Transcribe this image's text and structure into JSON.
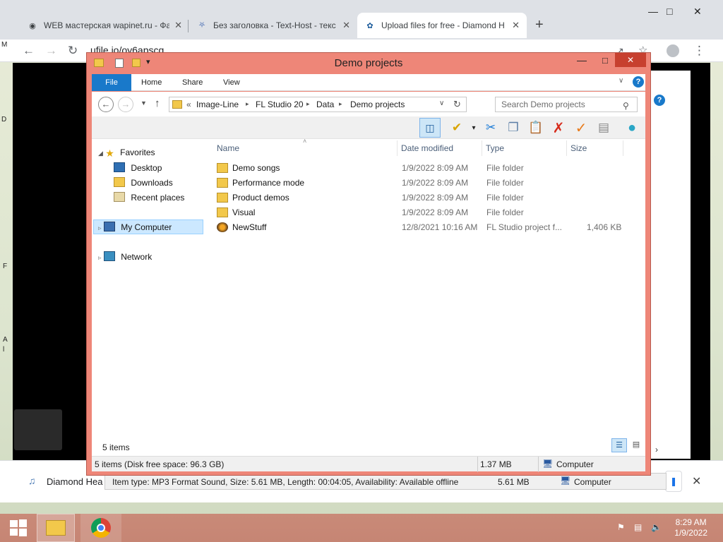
{
  "browser": {
    "tabs": [
      {
        "title": "WEB мастерская wapinet.ru - Фа",
        "icon": "eye-icon"
      },
      {
        "title": "Без заголовка - Text-Host - текс",
        "icon": "shield-icon"
      },
      {
        "title": "Upload files for free - Diamond H",
        "icon": "ufile-logo-icon",
        "active": true
      }
    ],
    "new_tab": "+",
    "url": "ufile.io/oy6apscg",
    "window_controls": {
      "minimize": "—",
      "maximize": "□",
      "close": "✕"
    }
  },
  "page": {
    "download_filename": "Diamond Hea",
    "side_letters": [
      "M",
      "D",
      "F",
      "A",
      "l"
    ]
  },
  "explorer": {
    "title": "Demo projects",
    "quick_access": {
      "dropdown": "▾"
    },
    "ribbon_tabs": [
      "File",
      "Home",
      "Share",
      "View"
    ],
    "address": {
      "prefix": "«",
      "crumbs": [
        "Image-Line",
        "FL Studio 20",
        "Data",
        "Demo projects"
      ]
    },
    "search_placeholder": "Search Demo projects",
    "nav": {
      "favorites": "Favorites",
      "favorite_items": [
        "Desktop",
        "Downloads",
        "Recent places"
      ],
      "computer": "My Computer",
      "network": "Network"
    },
    "columns": {
      "name": "Name",
      "date": "Date modified",
      "type": "Type",
      "size": "Size"
    },
    "files": [
      {
        "name": "Demo songs",
        "date": "1/9/2022 8:09 AM",
        "type": "File folder",
        "size": "",
        "icon": "folder-icon"
      },
      {
        "name": "Performance mode",
        "date": "1/9/2022 8:09 AM",
        "type": "File folder",
        "size": "",
        "icon": "folder-icon"
      },
      {
        "name": "Product demos",
        "date": "1/9/2022 8:09 AM",
        "type": "File folder",
        "size": "",
        "icon": "folder-icon"
      },
      {
        "name": "Visual",
        "date": "1/9/2022 8:09 AM",
        "type": "File folder",
        "size": "",
        "icon": "folder-icon"
      },
      {
        "name": "NewStuff",
        "date": "12/8/2021 10:16 AM",
        "type": "FL Studio project f...",
        "size": "1,406 KB",
        "icon": "fl-studio-icon"
      }
    ],
    "item_count": "5 items",
    "status": {
      "left": "5 items (Disk free space: 96.3 GB)",
      "size": "1.37 MB",
      "location": "Computer"
    }
  },
  "back_status": {
    "text": "Item type: MP3 Format Sound, Size: 5.61 MB, Length: 00:04:05, Availability: Available offline",
    "size": "5.61 MB",
    "location": "Computer"
  },
  "taskbar": {
    "time": "8:29 AM",
    "date": "1/9/2022"
  }
}
